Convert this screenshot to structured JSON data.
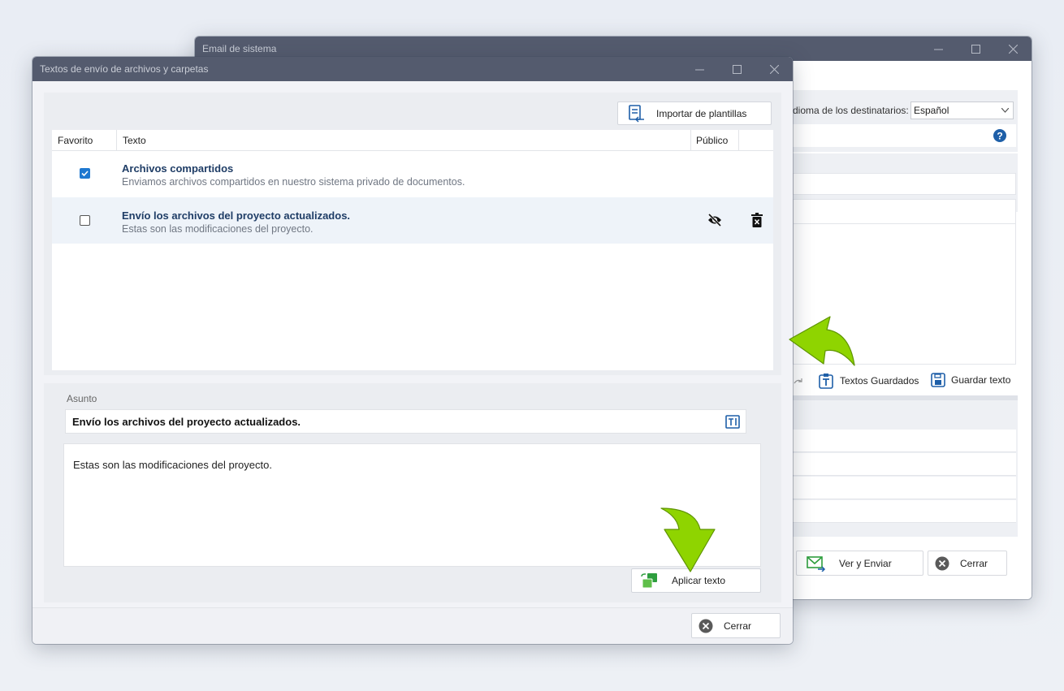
{
  "background_window": {
    "title": "Email de sistema",
    "language_label": "dioma de los destinatarios:",
    "language_value": "Español",
    "saved_texts_label": "Textos Guardados",
    "save_text_label": "Guardar texto",
    "view_send_label": "Ver y Enviar",
    "close_label": "Cerrar"
  },
  "dialog": {
    "title": "Textos de envío de archivos y carpetas",
    "import_label": "Importar de plantillas",
    "columns": {
      "favorite": "Favorito",
      "text": "Texto",
      "public": "Público"
    },
    "rows": [
      {
        "title": "Archivos compartidos",
        "description": "Enviamos archivos compartidos en nuestro sistema privado de documentos.",
        "favorite": true
      },
      {
        "title": "Envío los archivos del proyecto actualizados.",
        "description": "Estas son las modificaciones del proyecto.",
        "favorite": false
      }
    ],
    "subject_label": "Asunto",
    "subject_value": "Envío los archivos del proyecto actualizados.",
    "body_value": "Estas son las modificaciones del proyecto.",
    "apply_label": "Aplicar texto",
    "close_label": "Cerrar"
  },
  "colors": {
    "titlebar": "#545b6e",
    "accent_blue": "#1e78d0",
    "row_title": "#1f3d66",
    "arrow_green": "#8fd400"
  },
  "icons": [
    "minimize-icon",
    "maximize-icon",
    "close-icon",
    "import-templates-icon",
    "checkbox-checked-icon",
    "eye-off-icon",
    "trash-icon",
    "text-field-icon",
    "apply-text-icon",
    "cancel-circle-icon",
    "help-icon",
    "saved-texts-icon",
    "save-disk-icon",
    "mail-send-icon",
    "redo-icon",
    "dropdown-chevron-icon"
  ]
}
